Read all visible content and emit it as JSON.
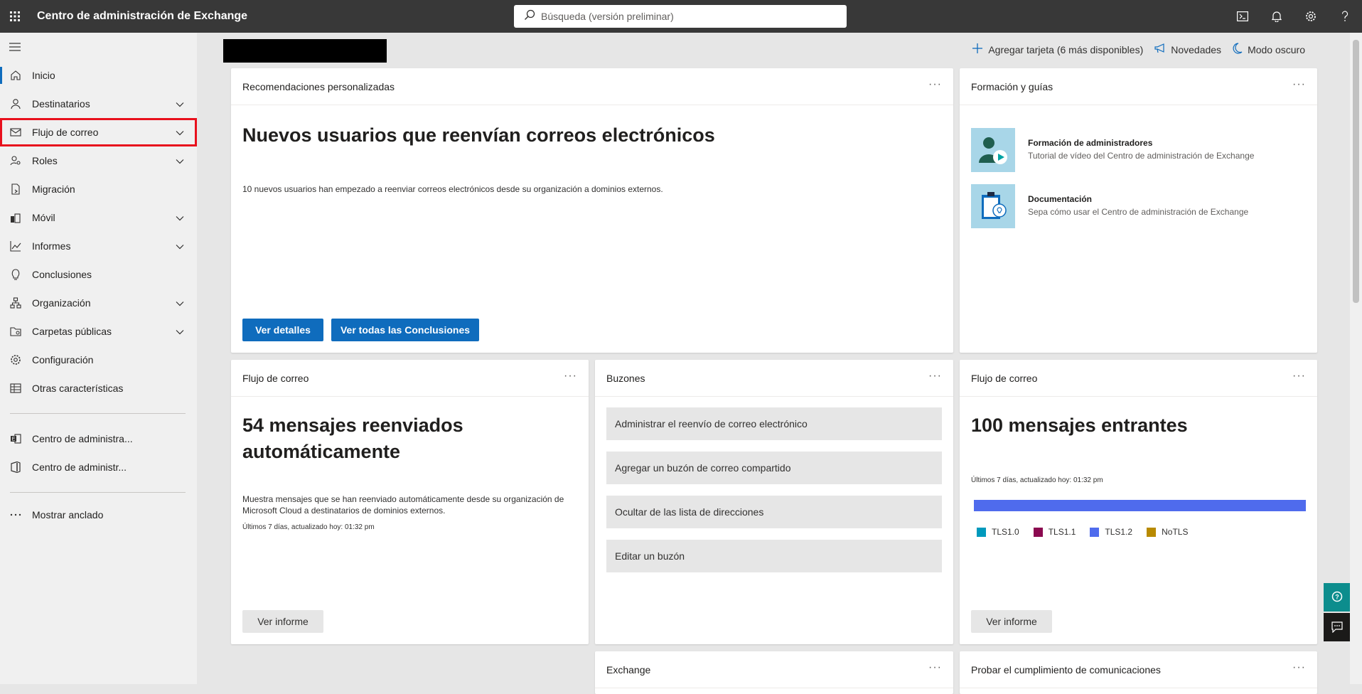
{
  "topbar": {
    "app_title": "Centro de administración de Exchange",
    "search_placeholder": "Búsqueda (versión preliminar)",
    "icons": [
      "cloud-shell-icon",
      "bell-icon",
      "gear-icon",
      "help-icon"
    ]
  },
  "sidebar": {
    "items": [
      {
        "label": "Inicio",
        "icon": "home-icon",
        "chevron": false
      },
      {
        "label": "Destinatarios",
        "icon": "person-icon",
        "chevron": true
      },
      {
        "label": "Flujo de correo",
        "icon": "mail-icon",
        "chevron": true
      },
      {
        "label": "Roles",
        "icon": "person-key-icon",
        "chevron": true
      },
      {
        "label": "Migración",
        "icon": "document-arrow-icon",
        "chevron": false
      },
      {
        "label": "Móvil",
        "icon": "mobile-icon",
        "chevron": true
      },
      {
        "label": "Informes",
        "icon": "chart-icon",
        "chevron": true
      },
      {
        "label": "Conclusiones",
        "icon": "lightbulb-icon",
        "chevron": false
      },
      {
        "label": "Organización",
        "icon": "org-icon",
        "chevron": true
      },
      {
        "label": "Carpetas públicas",
        "icon": "folder-icon",
        "chevron": true
      },
      {
        "label": "Configuración",
        "icon": "gear-icon",
        "chevron": false
      },
      {
        "label": "Otras características",
        "icon": "grid-icon",
        "chevron": false
      }
    ],
    "admin_links": [
      "Centro de administra...",
      "Centro de administr..."
    ],
    "show_pinned": "Mostrar anclado"
  },
  "header_actions": {
    "add_card": "Agregar tarjeta (6 más disponibles)",
    "whats_new": "Novedades",
    "dark_mode": "Modo oscuro"
  },
  "cards": {
    "recommendations": {
      "title": "Recomendaciones personalizadas",
      "headline": "Nuevos usuarios que reenvían correos electrónicos",
      "body": "10 nuevos usuarios han empezado a reenviar correos electrónicos desde su organización a dominios externos.",
      "btn_details": "Ver detalles",
      "btn_all": "Ver todas las Conclusiones"
    },
    "training": {
      "title": "Formación y guías",
      "items": [
        {
          "title": "Formación de administradores",
          "subtitle": "Tutorial de vídeo del Centro de administración de Exchange"
        },
        {
          "title": "Documentación",
          "subtitle": "Sepa cómo usar el Centro de administración de Exchange"
        }
      ]
    },
    "mailflow_forward": {
      "title": "Flujo de correo",
      "headline": "54 mensajes reenviados automáticamente",
      "body": "Muestra mensajes que se han reenviado automáticamente desde su organización de Microsoft Cloud a destinatarios de dominios externos.",
      "updated": "Últimos 7 días, actualizado hoy: 01:32 pm",
      "btn": "Ver informe"
    },
    "mailboxes": {
      "title": "Buzones",
      "buttons": [
        "Administrar el reenvío de correo electrónico",
        "Agregar un buzón de correo compartido",
        "Ocultar de las lista de direcciones",
        "Editar un buzón"
      ]
    },
    "mailflow_incoming": {
      "title": "Flujo de correo",
      "headline": "100 mensajes entrantes",
      "updated": "Últimos 7 días, actualizado hoy: 01:32 pm",
      "btn": "Ver informe",
      "legend": [
        {
          "name": "TLS1.0",
          "color": "#0099bc"
        },
        {
          "name": "TLS1.1",
          "color": "#8b0a50"
        },
        {
          "name": "TLS1.2",
          "color": "#4f6bed"
        },
        {
          "name": "NoTLS",
          "color": "#b88a00"
        }
      ],
      "bar_share": {
        "TLS1.0": 0,
        "TLS1.1": 0,
        "TLS1.2": 1,
        "NoTLS": 0
      }
    },
    "exchange": {
      "title": "Exchange"
    },
    "compliance": {
      "title": "Probar el cumplimiento de comunicaciones"
    }
  },
  "colors": {
    "accent": "#0f6cbd",
    "topbar": "#383838",
    "highlight": "#e8101d"
  }
}
